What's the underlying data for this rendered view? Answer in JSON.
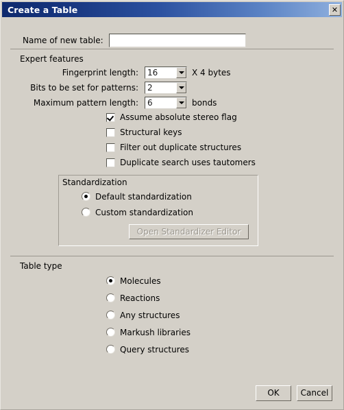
{
  "window": {
    "title": "Create a Table",
    "close_icon": "close-icon",
    "close_label": "✕"
  },
  "name_field": {
    "label": "Name of new table:",
    "value": "",
    "placeholder": ""
  },
  "expert_features": {
    "title": "Expert features",
    "combos": [
      {
        "label": "Fingerprint length:",
        "value": "16",
        "suffix": "X 4 bytes"
      },
      {
        "label": "Bits to be set for patterns:",
        "value": "2",
        "suffix": ""
      },
      {
        "label": "Maximum pattern length:",
        "value": "6",
        "suffix": "bonds"
      }
    ],
    "checkboxes": [
      {
        "label": "Assume absolute stereo flag",
        "checked": true
      },
      {
        "label": "Structural keys",
        "checked": false
      },
      {
        "label": "Filter out duplicate structures",
        "checked": false
      },
      {
        "label": "Duplicate search uses tautomers",
        "checked": false
      }
    ]
  },
  "standardization": {
    "title": "Standardization",
    "options": [
      {
        "label": "Default standardization",
        "selected": true
      },
      {
        "label": "Custom standardization",
        "selected": false
      }
    ],
    "editor_button": {
      "label": "Open Standardizer Editor",
      "enabled": false
    }
  },
  "table_type": {
    "title": "Table type",
    "options": [
      {
        "label": "Molecules",
        "selected": true
      },
      {
        "label": "Reactions",
        "selected": false
      },
      {
        "label": "Any structures",
        "selected": false
      },
      {
        "label": "Markush libraries",
        "selected": false
      },
      {
        "label": "Query structures",
        "selected": false
      }
    ]
  },
  "footer": {
    "ok_label": "OK",
    "cancel_label": "Cancel"
  },
  "colors": {
    "dialog_background": "#d4d0c8",
    "titlebar_start": "#0e2a6e",
    "titlebar_end": "#8fb0de",
    "title_text": "#ffffff",
    "field_background": "#ffffff",
    "separator": "#9a968e",
    "disabled_text": "#9c9890"
  }
}
